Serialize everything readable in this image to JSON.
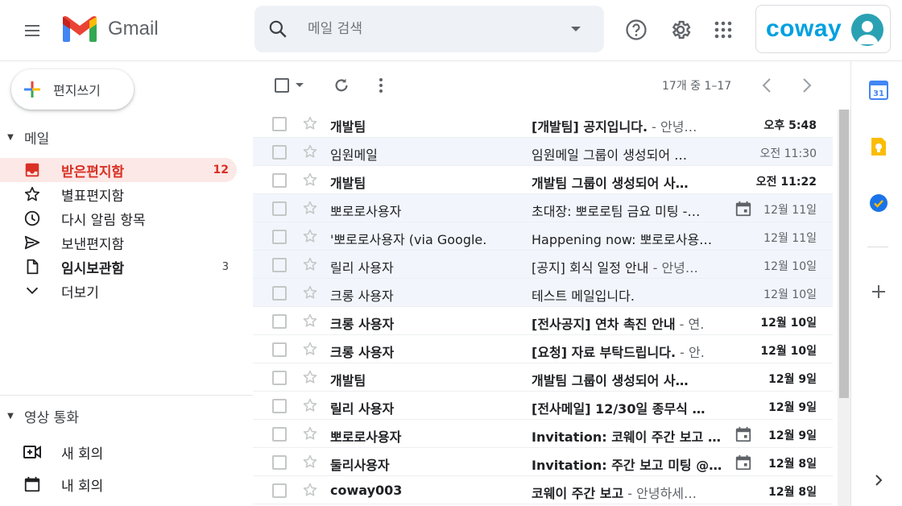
{
  "header": {
    "app_name": "Gmail",
    "search_placeholder": "메일 검색",
    "account_brand": "coway"
  },
  "sidebar": {
    "compose_label": "편지쓰기",
    "mail_section": "메일",
    "items": [
      {
        "label": "받은편지함",
        "count": "12",
        "icon": "inbox-icon"
      },
      {
        "label": "별표편지함",
        "count": "",
        "icon": "star-icon"
      },
      {
        "label": "다시 알림 항목",
        "count": "",
        "icon": "clock-icon"
      },
      {
        "label": "보낸편지함",
        "count": "",
        "icon": "send-icon"
      },
      {
        "label": "임시보관함",
        "count": "3",
        "icon": "draft-icon"
      },
      {
        "label": "더보기",
        "count": "",
        "icon": "chevron-down-icon"
      }
    ],
    "video_section": "영상 통화",
    "video_items": [
      {
        "label": "새 회의",
        "icon": "video-add-icon"
      },
      {
        "label": "내 회의",
        "icon": "calendar-icon"
      }
    ]
  },
  "toolbar": {
    "paging": "17개 중 1–17"
  },
  "emails": [
    {
      "sender": "개발팀",
      "subject": "[개발팀] 공지입니다.",
      "snippet": " - 안녕…",
      "date": "오후 5:48",
      "unread": true,
      "calendar": false
    },
    {
      "sender": "임원메일",
      "subject": "임원메일 그룹이 생성되어 …",
      "snippet": "",
      "date": "오전 11:30",
      "unread": false,
      "calendar": false
    },
    {
      "sender": "개발팀",
      "subject": "개발팀 그룹이 생성되어 사…",
      "snippet": "",
      "date": "오전 11:22",
      "unread": true,
      "calendar": false
    },
    {
      "sender": "뽀로로사용자",
      "subject": "초대장: 뽀로로팀 금요 미팅 -…",
      "snippet": "",
      "date": "12월 11일",
      "unread": false,
      "calendar": true
    },
    {
      "sender": "'뽀로로사용자 (via Google.",
      "subject": "Happening now: 뽀로로사용…",
      "snippet": "",
      "date": "12월 11일",
      "unread": false,
      "calendar": false
    },
    {
      "sender": "릴리 사용자",
      "subject": "[공지] 회식 일정 안내",
      "snippet": " - 안녕…",
      "date": "12월 10일",
      "unread": false,
      "calendar": false
    },
    {
      "sender": "크롱 사용자",
      "subject": "테스트 메일입니다.",
      "snippet": "",
      "date": "12월 10일",
      "unread": false,
      "calendar": false
    },
    {
      "sender": "크롱 사용자",
      "subject": "[전사공지] 연차 촉진 안내",
      "snippet": " - 연.",
      "date": "12월 10일",
      "unread": true,
      "calendar": false
    },
    {
      "sender": "크롱 사용자",
      "subject": "[요청] 자료 부탁드립니다.",
      "snippet": " - 안.",
      "date": "12월 10일",
      "unread": true,
      "calendar": false
    },
    {
      "sender": "개발팀",
      "subject": "개발팀 그룹이 생성되어 사…",
      "snippet": "",
      "date": "12월 9일",
      "unread": true,
      "calendar": false
    },
    {
      "sender": "릴리 사용자",
      "subject": "[전사메일] 12/30일 종무식 …",
      "snippet": "",
      "date": "12월 9일",
      "unread": true,
      "calendar": false
    },
    {
      "sender": "뽀로로사용자",
      "subject": "Invitation: 코웨이 주간 보고 …",
      "snippet": "",
      "date": "12월 9일",
      "unread": true,
      "calendar": true
    },
    {
      "sender": "둘리사용자",
      "subject": "Invitation: 주간 보고 미팅 @…",
      "snippet": "",
      "date": "12월 8일",
      "unread": true,
      "calendar": true
    },
    {
      "sender": "coway003",
      "subject": "코웨이 주간 보고",
      "snippet": " - 안녕하세…",
      "date": "12월 8일",
      "unread": true,
      "calendar": false
    }
  ],
  "rightbar": {
    "calendar_badge": "31"
  }
}
